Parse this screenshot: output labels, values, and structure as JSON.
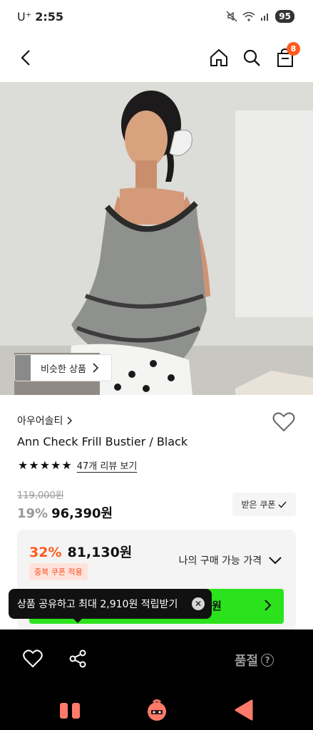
{
  "status_bar": {
    "carrier": "U⁺",
    "time": "2:55",
    "battery": "95"
  },
  "nav": {
    "cart_count": "8"
  },
  "product": {
    "similar_label": "비슷한 상품",
    "brand": "아우어솔티",
    "name": "Ann Check Frill Bustier / Black",
    "stars": "★★★★★",
    "review_link": "47개 리뷰 보기",
    "original_price": "119,000원",
    "discount_pct": "19%",
    "sale_price": "96,390원",
    "coupon_button": "받은 쿠폰"
  },
  "best_price": {
    "pct": "32%",
    "price": "81,130원",
    "duplicate_badge": "중복 쿠폰 적용",
    "my_price_label": "나의 구매 가능 가격"
  },
  "share_tooltip": {
    "text": "상품 공유하고 최대 2,910원 적립받기"
  },
  "green_button": {
    "visible_text": "원"
  },
  "action_bar": {
    "soldout": "품절",
    "help": "?"
  },
  "colors": {
    "accent": "#ff5a1f",
    "green": "#2be21c",
    "coupon_bg": "#ffe3db"
  }
}
